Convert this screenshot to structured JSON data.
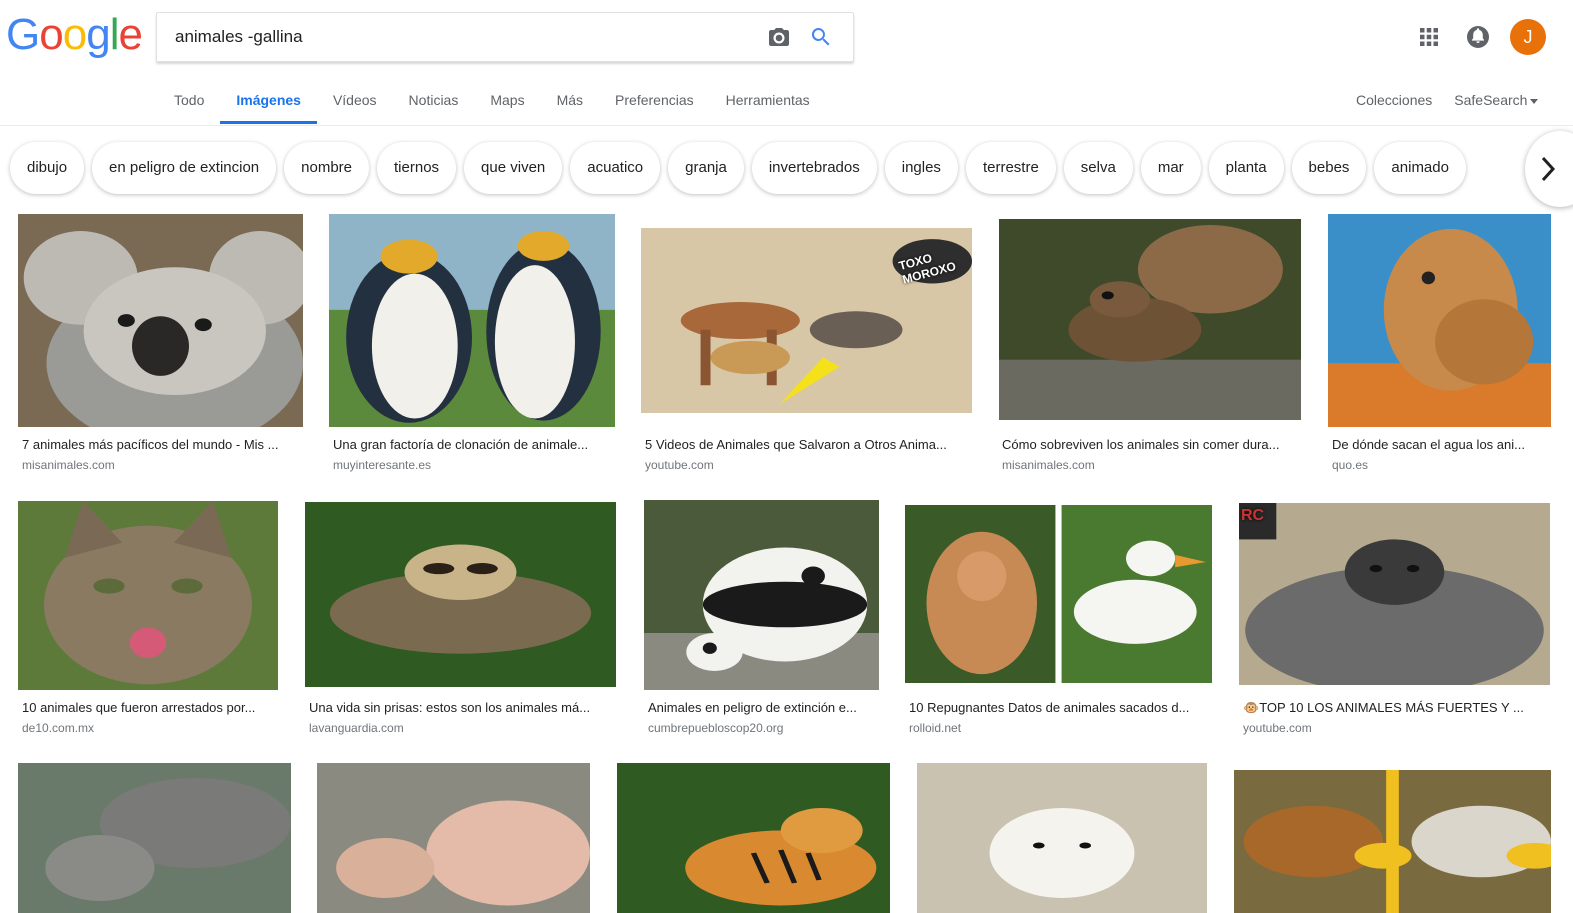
{
  "logo": {
    "text": "Google"
  },
  "colors": {
    "blue": "#4285f4",
    "red": "#ea4335",
    "yellow": "#fbbc05",
    "green": "#34a853",
    "active_tab": "#1a73e8",
    "avatar": "#e8710a"
  },
  "search": {
    "query": "animales -gallina"
  },
  "tabs": [
    {
      "label": "Todo"
    },
    {
      "label": "Imágenes"
    },
    {
      "label": "Vídeos"
    },
    {
      "label": "Noticias"
    },
    {
      "label": "Maps"
    },
    {
      "label": "Más"
    },
    {
      "label": "Preferencias"
    },
    {
      "label": "Herramientas"
    }
  ],
  "active_tab": "Imágenes",
  "right_links": {
    "collections": "Colecciones",
    "safesearch": "SafeSearch"
  },
  "avatar_letter": "J",
  "chips": [
    "dibujo",
    "en peligro de extincion",
    "nombre",
    "tiernos",
    "que viven",
    "acuatico",
    "granja",
    "invertebrados",
    "ingles",
    "terrestre",
    "selva",
    "mar",
    "planta",
    "bebes",
    "animado"
  ],
  "results": [
    {
      "title": "7 animales más pacíficos del mundo - Mis ...",
      "source": "misanimales.com",
      "icon": "koala"
    },
    {
      "title": "Una gran factoría de clonación de animale...",
      "source": "muyinteresante.es",
      "icon": "penguins"
    },
    {
      "title": "5 Videos de Animales que Salvaron a Otros Anima...",
      "source": "youtube.com",
      "icon": "antelope-leopard-baboon",
      "overlay_text": "TOXO MOROXO"
    },
    {
      "title": "Cómo sobreviven los animales sin comer dura...",
      "source": "misanimales.com",
      "icon": "squirrel"
    },
    {
      "title": "De dónde sacan el agua los ani...",
      "source": "quo.es",
      "icon": "camel"
    },
    {
      "title": "10 animales que fueron arrestados por...",
      "source": "de10.com.mx",
      "icon": "cat"
    },
    {
      "title": "Una vida sin prisas: estos son los animales má...",
      "source": "lavanguardia.com",
      "icon": "sloth"
    },
    {
      "title": "Animales en peligro de extinción e...",
      "source": "cumbrepuebloscop20.org",
      "icon": "panda"
    },
    {
      "title": "10 Repugnantes Datos de animales sacados d...",
      "source": "rolloid.net",
      "icon": "monkey-duck"
    },
    {
      "title": "TOP 10 LOS ANIMALES MÁS FUERTES Y ...",
      "emoji": "🐵",
      "source": "youtube.com",
      "icon": "gorilla",
      "overlay_text": "RC"
    },
    {
      "title": "",
      "source": "",
      "icon": "elephants"
    },
    {
      "title": "",
      "source": "",
      "icon": "pigs"
    },
    {
      "title": "",
      "source": "",
      "icon": "tiger"
    },
    {
      "title": "",
      "source": "",
      "icon": "puppy"
    },
    {
      "title": "",
      "source": "",
      "icon": "dog-wolf"
    }
  ]
}
